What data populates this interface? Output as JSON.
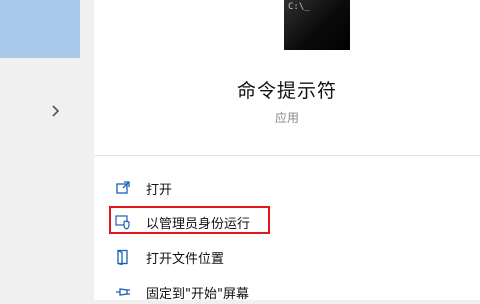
{
  "app": {
    "title": "命令提示符",
    "type": "应用",
    "icon": "command-prompt-icon"
  },
  "menu": [
    {
      "label": "打开",
      "icon": "open-icon"
    },
    {
      "label": "以管理员身份运行",
      "icon": "shield-admin-icon"
    },
    {
      "label": "打开文件位置",
      "icon": "file-location-icon"
    },
    {
      "label": "固定到\"开始\"屏幕",
      "icon": "pin-icon"
    }
  ],
  "colors": {
    "accent": "#1a5fb4",
    "selection": "#a9c9ea",
    "highlight_border": "#e0161b"
  }
}
